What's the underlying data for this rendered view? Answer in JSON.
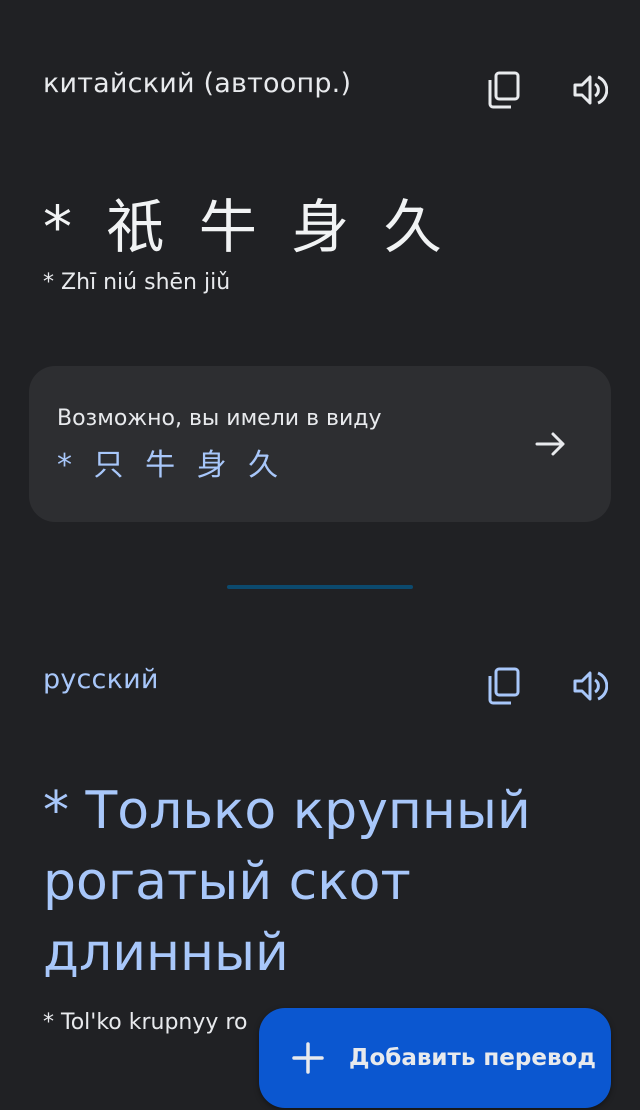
{
  "source": {
    "language_label": "китайский (автоопр.)",
    "text": "* 祇 牛 身 久",
    "transliteration": "* Zhī niú shēn jiǔ"
  },
  "suggestion": {
    "label": "Возможно, вы имели в виду",
    "text": "* 只 牛 身 久"
  },
  "target": {
    "language_label": "русский",
    "text": "* Только крупный рогатый скот длинный",
    "transliteration": "* Tol'ko krupnyy ro"
  },
  "fab": {
    "label": "Добавить перевод"
  },
  "icons": {
    "copy": "copy-icon",
    "speaker": "speaker-icon",
    "arrow": "arrow-right-icon",
    "plus": "plus-icon"
  },
  "colors": {
    "background": "#202124",
    "accent": "#a8c7fa",
    "card": "#2d2e31",
    "fab": "#0b57d0"
  }
}
